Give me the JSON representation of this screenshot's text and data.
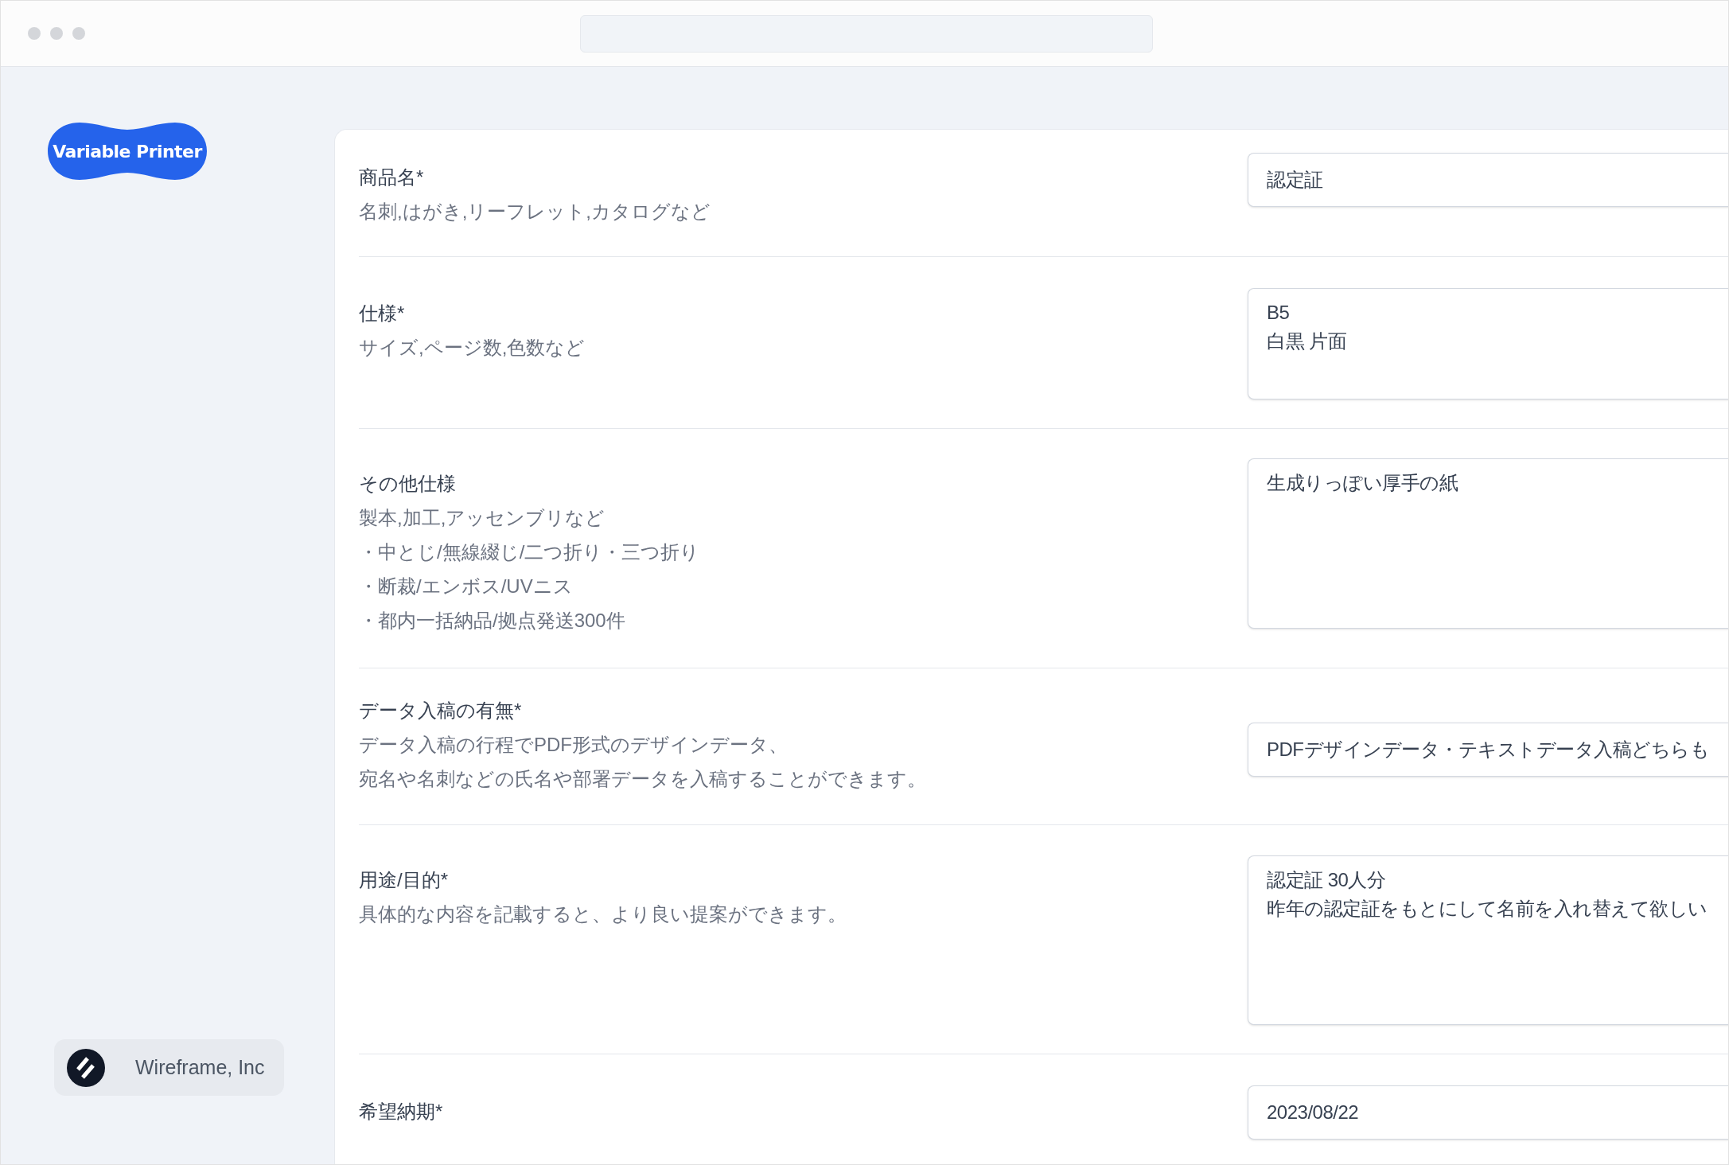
{
  "brand": {
    "name": "Variable Printer"
  },
  "form": {
    "fields": [
      {
        "label": "商品名*",
        "hints": [
          "名刺,はがき,リーフレット,カタログなど"
        ],
        "kind": "input",
        "value_lines": [
          "認定証"
        ]
      },
      {
        "label": "仕様*",
        "hints": [
          "サイズ,ページ数,色数など"
        ],
        "kind": "textarea",
        "value_lines": [
          "B5",
          "白黒 片面"
        ]
      },
      {
        "label": "その他仕様",
        "hints": [
          "製本,加工,アッセンブリなど",
          "・中とじ/無線綴じ/二つ折り・三つ折り",
          "・断裁/エンボス/UVニス",
          "・都内一括納品/拠点発送300件"
        ],
        "kind": "textarea",
        "value_lines": [
          "生成りっぽい厚手の紙"
        ]
      },
      {
        "label": "データ入稿の有無*",
        "hints": [
          "データ入稿の行程でPDF形式のデザインデータ、",
          "宛名や名刺などの氏名や部署データを入稿することができます。"
        ],
        "kind": "input",
        "value_lines": [
          "PDFデザインデータ・テキストデータ入稿どちらも"
        ]
      },
      {
        "label": "用途/目的*",
        "hints": [
          "具体的な内容を記載すると、より良い提案ができます。"
        ],
        "kind": "textarea",
        "value_lines": [
          "認定証 30人分",
          "昨年の認定証をもとにして名前を入れ替えて欲しい"
        ]
      },
      {
        "label": "希望納期*",
        "kind": "input",
        "value_lines": [
          "2023/08/22"
        ]
      }
    ]
  },
  "company": {
    "name": "Wireframe, Inc"
  }
}
